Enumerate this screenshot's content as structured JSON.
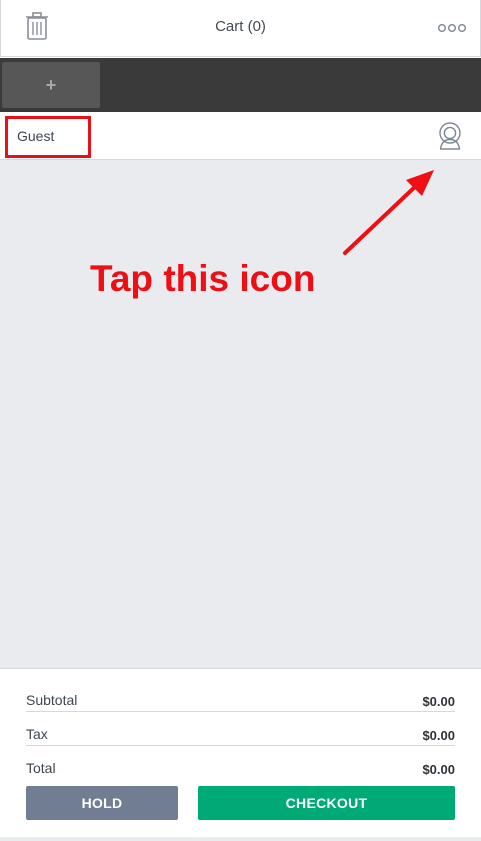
{
  "header": {
    "title": "Cart (0)",
    "left_icon": "trash-icon",
    "right_icon": "more-icon"
  },
  "tabs": {
    "add_label": "+"
  },
  "customer": {
    "name": "Guest",
    "icon": "person-icon"
  },
  "annotation": {
    "text": "Tap this icon",
    "color": "#ee0e14"
  },
  "totals": {
    "rows": [
      {
        "label": "Subtotal",
        "value": "$0.00"
      },
      {
        "label": "Tax",
        "value": "$0.00"
      },
      {
        "label": "Total",
        "value": "$0.00"
      }
    ]
  },
  "actions": {
    "hold_label": "HOLD",
    "checkout_label": "CHECKOUT",
    "hold_color": "#707d93",
    "checkout_color": "#00aa76"
  }
}
